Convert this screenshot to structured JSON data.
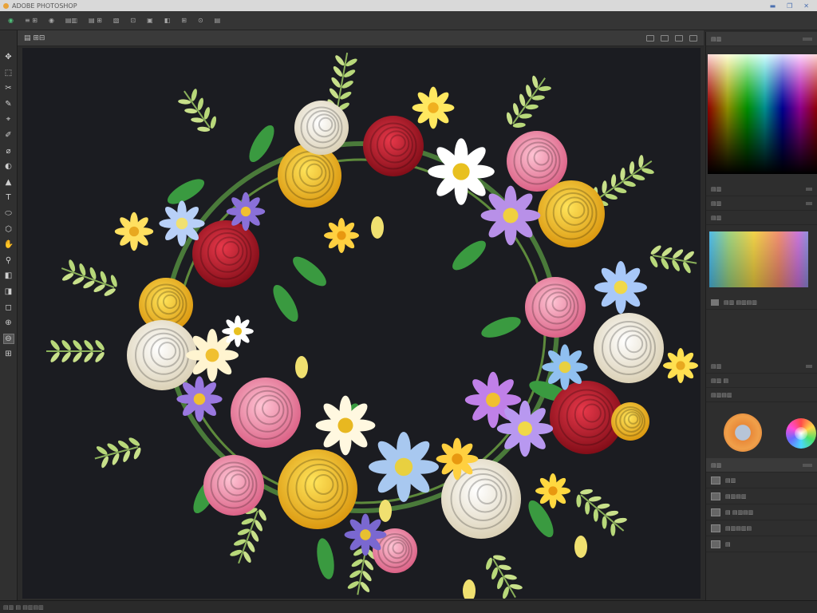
{
  "window": {
    "title": "ADOBE PHOTOSHOP"
  },
  "menu": {
    "items": [
      "≡ ⊞",
      "◉",
      "▤▥",
      "▤ ⊞",
      "▧",
      "⊡",
      "▣",
      "◧",
      "⊞",
      "⊙",
      "▤"
    ]
  },
  "options": {
    "label": "▤ ⊞⊟"
  },
  "tools": [
    "✥",
    "⬚",
    "✂",
    "✎",
    "⌖",
    "✐",
    "⌀",
    "◐",
    "▲",
    "T",
    "⬭",
    "⬡",
    "✋",
    "⚲",
    "◧",
    "◨",
    "◻",
    "⊕",
    "⊖",
    "⊞"
  ],
  "right_panel": {
    "color_header": "▤▥",
    "rows_a": [
      "▤▥",
      "▤▥"
    ],
    "swatch_label": "▤▥",
    "rows_b": [
      "▤▥ ▤▥▤▥"
    ],
    "rows_c": [
      "▤▥",
      "▤▥ ▤",
      "▤▥▤▥"
    ],
    "layers_header": "▤▥",
    "layers": [
      "▤▥",
      "▤▥▤▥",
      "▤ ▤▥▤▥",
      "▤▥▤▥▤",
      "▤"
    ]
  },
  "status": {
    "text": "▤▥ ▤ ▤▥▤▥"
  },
  "colors": {
    "canvas_bg": "#1b1c21",
    "red_rose": "#c8182a",
    "yellow_rose": "#f5c21a",
    "pink_rose": "#f08aa8",
    "cream_rose": "#f3ecd8",
    "leaf": "#3a9a40"
  }
}
